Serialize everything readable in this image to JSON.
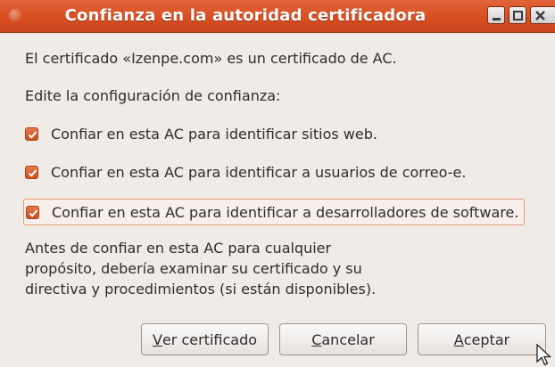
{
  "window": {
    "title": "Confianza en la autoridad certificadora"
  },
  "content": {
    "intro": "El certificado «Izenpe.com» es un certificado de AC.",
    "edit_prompt": "Edite la configuración de confianza:",
    "options": [
      {
        "label": "Confiar en esta AC para identificar sitios web.",
        "checked": true
      },
      {
        "label": "Confiar en esta AC para identificar a usuarios de correo-e.",
        "checked": true
      },
      {
        "label": "Confiar en esta AC para identificar a desarrolladores de software.",
        "checked": true
      }
    ],
    "advice_lines": [
      "Antes de confiar en esta AC para cualquier",
      "propósito, debería examinar su certificado y su",
      "directiva y procedimientos (si están disponibles)."
    ]
  },
  "buttons": {
    "view_cert": {
      "mnemonic": "V",
      "rest": "er certificado"
    },
    "cancel": {
      "mnemonic": "C",
      "rest": "ancelar"
    },
    "accept": {
      "mnemonic": "A",
      "rest": "ceptar"
    }
  },
  "colors": {
    "titlebar": "#d94f22",
    "checkbox": "#d35a2a",
    "window_bg": "#f0ebe6",
    "focus_border": "#e89a7a"
  },
  "icons": {
    "checkbox_mark": "checkmark-icon",
    "minimize": "minimize-icon",
    "maximize": "maximize-icon",
    "close": "close-icon",
    "cursor": "mouse-pointer-icon"
  }
}
